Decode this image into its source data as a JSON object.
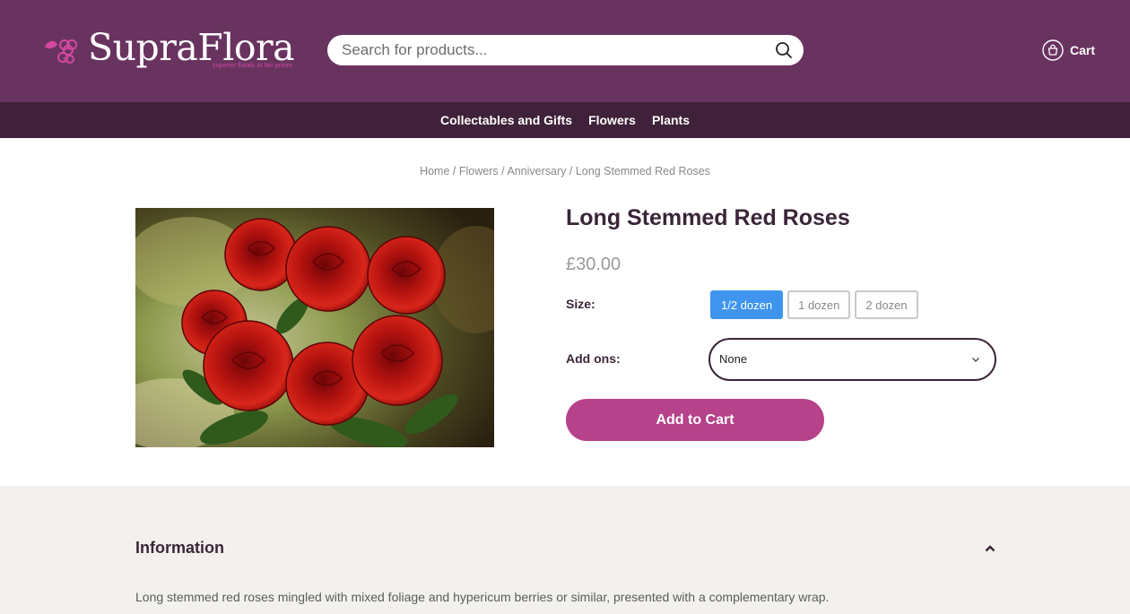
{
  "header": {
    "logo_text": "SupraFlora",
    "logo_tagline": "superior florals at fair prices",
    "search_placeholder": "Search for products...",
    "cart_label": "Cart"
  },
  "nav": {
    "items": [
      "Collectables and Gifts",
      "Flowers",
      "Plants"
    ]
  },
  "breadcrumb": {
    "items": [
      "Home",
      "Flowers",
      "Anniversary"
    ],
    "current": "Long Stemmed Red Roses",
    "separator": "/"
  },
  "product": {
    "title": "Long Stemmed Red Roses",
    "price": "£30.00",
    "image_alt_icon": "red-roses-photo",
    "size_label": "Size:",
    "sizes": [
      {
        "label": "1/2 dozen",
        "selected": true
      },
      {
        "label": "1 dozen",
        "selected": false
      },
      {
        "label": "2 dozen",
        "selected": false
      }
    ],
    "addons_label": "Add ons:",
    "addons_value": "None",
    "add_to_cart_label": "Add to Cart"
  },
  "info": {
    "title": "Information",
    "text": "Long stemmed red roses mingled with mixed foliage and hypericum berries or similar, presented with a complementary wrap."
  },
  "colors": {
    "header_bg": "#693360",
    "nav_bg": "#3f2239",
    "accent_pink": "#b5428a",
    "selected_size": "#3f95ee",
    "info_bg": "#f3f1ee"
  }
}
